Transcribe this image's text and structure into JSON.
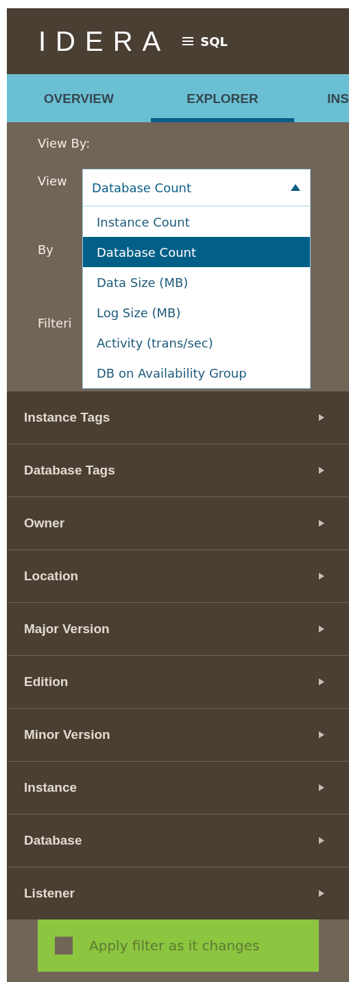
{
  "header": {
    "logo": "IDERA",
    "menu_label": "SQL"
  },
  "tabs": [
    {
      "label": "OVERVIEW",
      "selected": false
    },
    {
      "label": "EXPLORER",
      "selected": true
    },
    {
      "label": "INS",
      "selected": false
    }
  ],
  "view_by": {
    "title": "View By:",
    "labels": [
      "View",
      "By",
      "Filteri"
    ]
  },
  "dropdown": {
    "value": "Database Count",
    "expanded": true,
    "options": [
      {
        "label": "Instance Count",
        "selected": false
      },
      {
        "label": "Database Count",
        "selected": true
      },
      {
        "label": "Data Size (MB)",
        "selected": false
      },
      {
        "label": "Log Size (MB)",
        "selected": false
      },
      {
        "label": "Activity (trans/sec)",
        "selected": false
      },
      {
        "label": "DB on Availability Group",
        "selected": false
      }
    ]
  },
  "filters": [
    {
      "label": "Instance Tags"
    },
    {
      "label": "Database Tags"
    },
    {
      "label": "Owner"
    },
    {
      "label": "Location"
    },
    {
      "label": "Major Version"
    },
    {
      "label": "Edition"
    },
    {
      "label": "Minor Version"
    },
    {
      "label": "Instance"
    },
    {
      "label": "Database"
    },
    {
      "label": "Listener"
    }
  ],
  "apply": {
    "label": "Apply filter as it changes",
    "checked": false
  }
}
